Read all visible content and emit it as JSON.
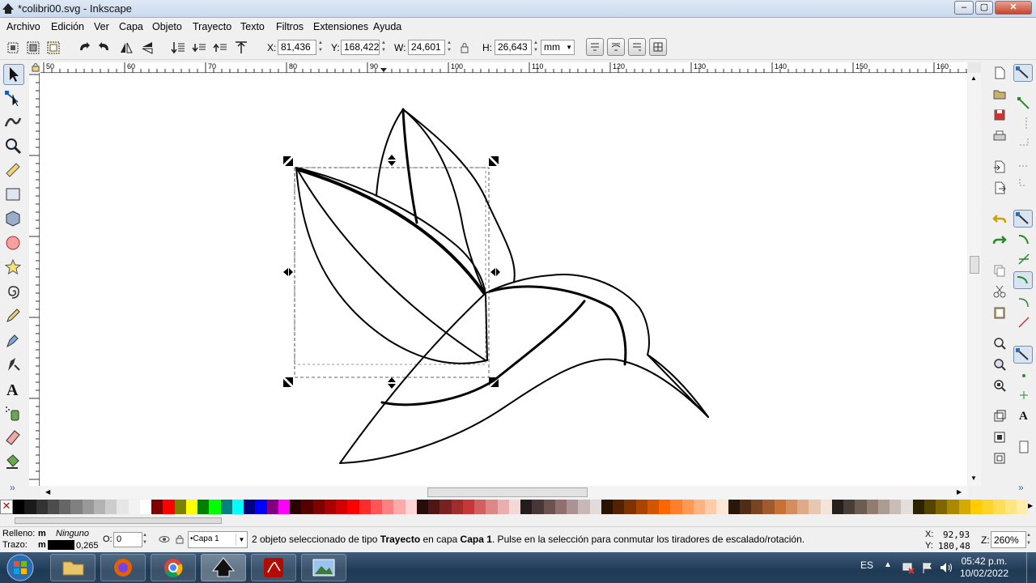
{
  "window": {
    "title": "*colibri00.svg - Inkscape"
  },
  "menu": [
    "Archivo",
    "Edición",
    "Ver",
    "Capa",
    "Objeto",
    "Trayecto",
    "Texto",
    "Filtros",
    "Extensiones",
    "Ayuda"
  ],
  "toolbar": {
    "x_label": "X:",
    "x_value": "81,436",
    "y_label": "Y:",
    "y_value": "168,422",
    "w_label": "W:",
    "w_value": "24,601",
    "h_label": "H:",
    "h_value": "26,643",
    "unit": "mm"
  },
  "ruler": {
    "ticks": [
      "50",
      "60",
      "70",
      "80",
      "90",
      "100",
      "110",
      "120",
      "130",
      "140",
      "150",
      "160"
    ]
  },
  "palette": {
    "colors": [
      "#000000",
      "#1a1a1a",
      "#333333",
      "#4d4d4d",
      "#666666",
      "#808080",
      "#999999",
      "#b3b3b3",
      "#cccccc",
      "#e6e6e6",
      "#f2f2f2",
      "#ffffff",
      "#800000",
      "#ff0000",
      "#808000",
      "#ffff00",
      "#008000",
      "#00ff00",
      "#008080",
      "#00ffff",
      "#000080",
      "#0000ff",
      "#800080",
      "#ff00ff",
      "#2b0000",
      "#550000",
      "#800000",
      "#aa0000",
      "#d40000",
      "#ff0000",
      "#ff2a2a",
      "#ff5555",
      "#ff8080",
      "#ffaaaa",
      "#ffd5d5",
      "#280b0b",
      "#501616",
      "#782121",
      "#a02c2c",
      "#c83737",
      "#d35f5f",
      "#de8787",
      "#e9afaf",
      "#f4d7d7",
      "#241c1c",
      "#483737",
      "#6c5353",
      "#916f6f",
      "#ac9393",
      "#c8b7b7",
      "#e3dbdb",
      "#2b1100",
      "#552200",
      "#803300",
      "#aa4400",
      "#d45500",
      "#ff6600",
      "#ff7f2a",
      "#ff9955",
      "#ffb380",
      "#ffccaa",
      "#ffe6d5",
      "#28170b",
      "#502d16",
      "#784421",
      "#a05a2c",
      "#c87137",
      "#d38d5f",
      "#deaa87",
      "#e9c6af",
      "#f4e3d7",
      "#241f1c",
      "#483e37",
      "#6c5d53",
      "#917c6f",
      "#ac9d93",
      "#c8beb7",
      "#e3dedb",
      "#2b2200",
      "#554400",
      "#806600",
      "#aa8800",
      "#d4aa00",
      "#ffcc00",
      "#ffd42a",
      "#ffdd55",
      "#ffe680",
      "#ffeeaa"
    ]
  },
  "status": {
    "fill_label": "Relleno:",
    "fill_m": "m",
    "fill_value": "Ninguno",
    "stroke_label": "Trazo:",
    "stroke_m": "m",
    "stroke_width": "0,265",
    "opacity_label": "O:",
    "opacity_value": "0",
    "layer": "•Capa 1",
    "message_pre": "2 objeto seleccionado de tipo ",
    "message_type": "Trayecto",
    "message_mid": " en capa ",
    "message_layer": "Capa 1",
    "message_post": ". Pulse en la selección para conmutar los tiradores de escalado/rotación.",
    "cursor_x_label": "X:",
    "cursor_x": "92,93",
    "cursor_y_label": "Y:",
    "cursor_y": "180,48",
    "zoom_label": "Z:",
    "zoom_value": "260%"
  },
  "taskbar": {
    "lang": "ES",
    "time": "05:42 p.m.",
    "date": "10/02/2022"
  }
}
